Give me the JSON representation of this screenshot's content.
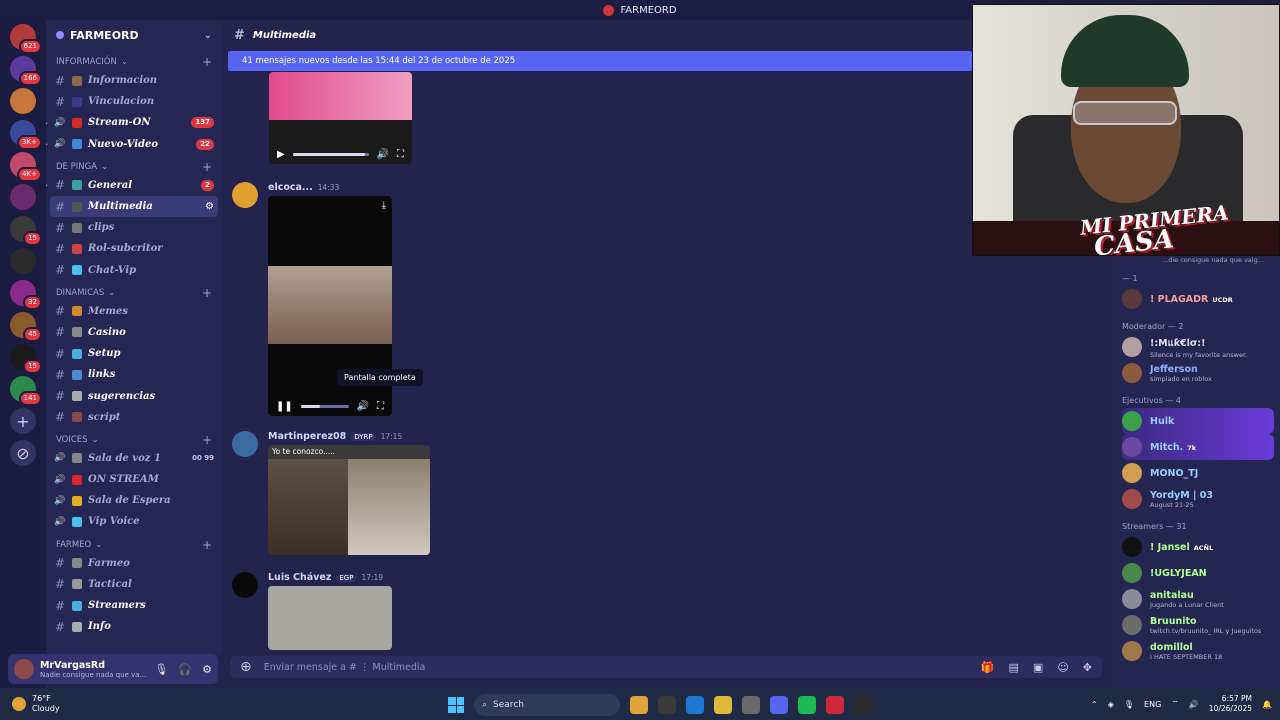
{
  "window": {
    "title": "FARMEORD"
  },
  "rail": {
    "servers": [
      {
        "color": "#b23a3a",
        "badge": "621"
      },
      {
        "color": "#5b3a9a",
        "badge": "166"
      },
      {
        "color": "#c7753a",
        "badge": ""
      },
      {
        "color": "#3a4a9a",
        "badge": "3K+"
      },
      {
        "color": "#c24a6a",
        "badge": "4K+"
      },
      {
        "color": "#6b2a6b",
        "badge": ""
      },
      {
        "color": "#3a3a3a",
        "badge": "15"
      },
      {
        "color": "#2a2a2a",
        "badge": ""
      },
      {
        "color": "#8a2a8a",
        "badge": "32"
      },
      {
        "color": "#8a5a2a",
        "badge": "45"
      },
      {
        "color": "#1a1a1a",
        "badge": "15"
      },
      {
        "color": "#2a8a4a",
        "badge": "141"
      }
    ],
    "add_label": "+",
    "explore_label": "⊘"
  },
  "sidebar": {
    "guild_name": "FARMEORD",
    "categories": [
      {
        "name": "INFORMACIÓN",
        "channels": [
          {
            "name": "Informacion",
            "emoji": "#8a6a4a",
            "count": "",
            "style": "normal"
          },
          {
            "name": "Vinculacion",
            "emoji": "#3a3a8a",
            "count": "",
            "style": "normal"
          },
          {
            "name": "Stream-ON",
            "emoji": "#d42a2a",
            "count": "137",
            "style": "bold",
            "voice": true
          },
          {
            "name": "Nuevo-Video",
            "emoji": "#3a8ad4",
            "count": "22",
            "style": "bold",
            "voice": true
          }
        ]
      },
      {
        "name": "DE PINGA",
        "channels": [
          {
            "name": "General",
            "emoji": "#3aa0a0",
            "count": "2",
            "style": "bold"
          },
          {
            "name": "Multimedia",
            "emoji": "#555",
            "count": "",
            "style": "active"
          },
          {
            "name": "clips",
            "emoji": "#777",
            "count": "",
            "style": "normal"
          },
          {
            "name": "Rol-subcritor",
            "emoji": "#c44",
            "count": "",
            "style": "normal"
          },
          {
            "name": "Chat-Vip",
            "emoji": "#4ac0f0",
            "count": "",
            "style": "normal"
          }
        ]
      },
      {
        "name": "DINAMICAS",
        "channels": [
          {
            "name": "Memes",
            "emoji": "#d08a2a",
            "count": "",
            "style": "normal"
          },
          {
            "name": "Casino",
            "emoji": "#888",
            "count": "",
            "style": "bold"
          },
          {
            "name": "Setup",
            "emoji": "#4ab0e0",
            "count": "",
            "style": "bold"
          },
          {
            "name": "links",
            "emoji": "#4a8ad0",
            "count": "",
            "style": "bold"
          },
          {
            "name": "sugerencias",
            "emoji": "#aaa",
            "count": "",
            "style": "bold"
          },
          {
            "name": "script",
            "emoji": "#8a4a4a",
            "count": "",
            "style": "normal"
          }
        ]
      },
      {
        "name": "VOICES",
        "channels": [
          {
            "name": "Sala de voz 1",
            "emoji": "#888",
            "count": "",
            "style": "normal",
            "voice": true,
            "extra": "00 99"
          },
          {
            "name": "ON STREAM",
            "emoji": "#d42a2a",
            "count": "",
            "style": "normal",
            "voice": true
          },
          {
            "name": "Sala de Espera",
            "emoji": "#e0b020",
            "count": "",
            "style": "normal",
            "voice": true
          },
          {
            "name": "Vip Voice",
            "emoji": "#4ac0f0",
            "count": "",
            "style": "normal",
            "voice": true
          }
        ]
      },
      {
        "name": "FARMEO",
        "channels": [
          {
            "name": "Farmeo",
            "emoji": "#888",
            "count": "",
            "style": "normal"
          },
          {
            "name": "Tactical",
            "emoji": "#999",
            "count": "",
            "style": "normal"
          },
          {
            "name": "Streamers",
            "emoji": "#4ab0e0",
            "count": "",
            "style": "bold"
          },
          {
            "name": "Info",
            "emoji": "#aaa",
            "count": "",
            "style": "bold"
          }
        ]
      }
    ]
  },
  "user_panel": {
    "name": "MrVargasRd",
    "status": "Nadie consigue nada que va..."
  },
  "chat": {
    "channel_name": "Multimedia",
    "new_messages_bar": "41 mensajes nuevos desde las 15:44 del 23 de octubre de 2025",
    "messages": [
      {
        "author": "elcoca...",
        "tag": "",
        "time": "14:33",
        "avatar_color": "#e0a030"
      },
      {
        "author": "Martinperez08",
        "tag": "DYRP",
        "time": "17:15",
        "avatar_color": "#3a6aa0"
      },
      {
        "author": "Luis Chávez",
        "tag": "EGP",
        "time": "17:19",
        "avatar_color": "#0a0a0a"
      }
    ],
    "video_caption": "Yo te conozco.....",
    "tooltip": "Pantalla completa",
    "composer_placeholder": "Enviar mensaje a # ⋮ Multimedia"
  },
  "webcam": {
    "brand_line1": "MI PRIMERA",
    "brand_line2": "CASA"
  },
  "members": {
    "status_snippet": "...die consigue nada que valg...",
    "groups": [
      {
        "title": "— 1",
        "items": [
          {
            "name": "! PLAGADR",
            "sub": "",
            "color": "#f0a0a0",
            "av": "#5a3a3a",
            "badge": "UCDR"
          }
        ]
      },
      {
        "title": "Moderador — 2",
        "items": [
          {
            "name": "!:Mแƙ€lσ:!",
            "sub": "Silence is my favorite answer.",
            "color": "#dcdcf0",
            "av": "#b0a0a0"
          },
          {
            "name": "Jefferson",
            "sub": "simpiado en roblox",
            "color": "#8ab0ff",
            "av": "#8a5a3a"
          }
        ]
      },
      {
        "title": "Ejecutivos — 4",
        "items": [
          {
            "name": "Hulk",
            "sub": "",
            "color": "#9ad0ff",
            "av": "#3aa04a",
            "hl": true
          },
          {
            "name": "Mitch.",
            "sub": "",
            "color": "#9ad0ff",
            "av": "#6a4aa0",
            "hl": true,
            "badge": "7k"
          },
          {
            "name": "MONO_TJ",
            "sub": "",
            "color": "#9ad0ff",
            "av": "#d0a050"
          },
          {
            "name": "YordyM | 03",
            "sub": "August 21-25",
            "color": "#9ad0ff",
            "av": "#a04a4a"
          }
        ]
      },
      {
        "title": "Streamers — 31",
        "items": [
          {
            "name": "! Jansel",
            "sub": "",
            "color": "#b0ff90",
            "av": "#111",
            "badge": "ACÑL"
          },
          {
            "name": "!UGLYJEAN",
            "sub": "",
            "color": "#b0ff90",
            "av": "#4a8a4a"
          },
          {
            "name": "anitalau",
            "sub": "Jugando a Lunar Client",
            "color": "#b0ff90",
            "av": "#8a8a9a"
          },
          {
            "name": "Bruunito",
            "sub": "twitch.tv/bruunito_ IRL y Jueguitos",
            "color": "#b0ff90",
            "av": "#6a6a6a"
          },
          {
            "name": "domillol",
            "sub": "I HATE SEPTEMBER 18",
            "color": "#b0ff90",
            "av": "#a07a4a"
          }
        ]
      }
    ]
  },
  "taskbar": {
    "temp": "76°F",
    "weather": "Cloudy",
    "search": "Search",
    "lang": "ENG",
    "time": "6:57 PM",
    "date": "10/26/2025",
    "apps": [
      "#e0a43a",
      "#3a3a3a",
      "#1e7ad0",
      "#e0b83a",
      "#6a6a6a",
      "#5865f2",
      "#1db954",
      "#d0283a",
      "#2a2a2a"
    ]
  }
}
